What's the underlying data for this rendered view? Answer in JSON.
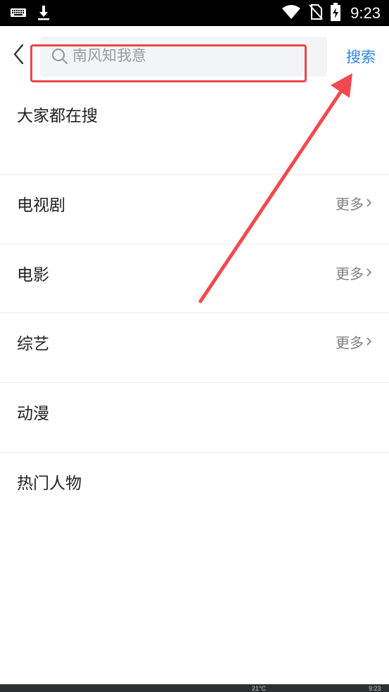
{
  "status_bar": {
    "time": "9:23",
    "icons": [
      "keyboard-icon",
      "download-icon",
      "wifi-icon",
      "no-sim-icon",
      "battery-charging-icon"
    ]
  },
  "header": {
    "back_icon": "chevron-left-icon",
    "search_placeholder": "南风知我意",
    "search_icon": "search-icon",
    "search_button": "搜索"
  },
  "hot_section": {
    "title": "大家都在搜"
  },
  "sections": [
    {
      "title": "电视剧",
      "more": "更多"
    },
    {
      "title": "电影",
      "more": "更多"
    },
    {
      "title": "综艺",
      "more": "更多"
    },
    {
      "title": "动漫",
      "more": ""
    },
    {
      "title": "热门人物",
      "more": ""
    }
  ],
  "bottom_bar": {
    "weather": "21°C",
    "time": "9:23"
  },
  "colors": {
    "accent": "#2e84e8",
    "annotation": "#e8474b",
    "search_bg": "#f3f4f6",
    "status_bg": "#000000"
  }
}
